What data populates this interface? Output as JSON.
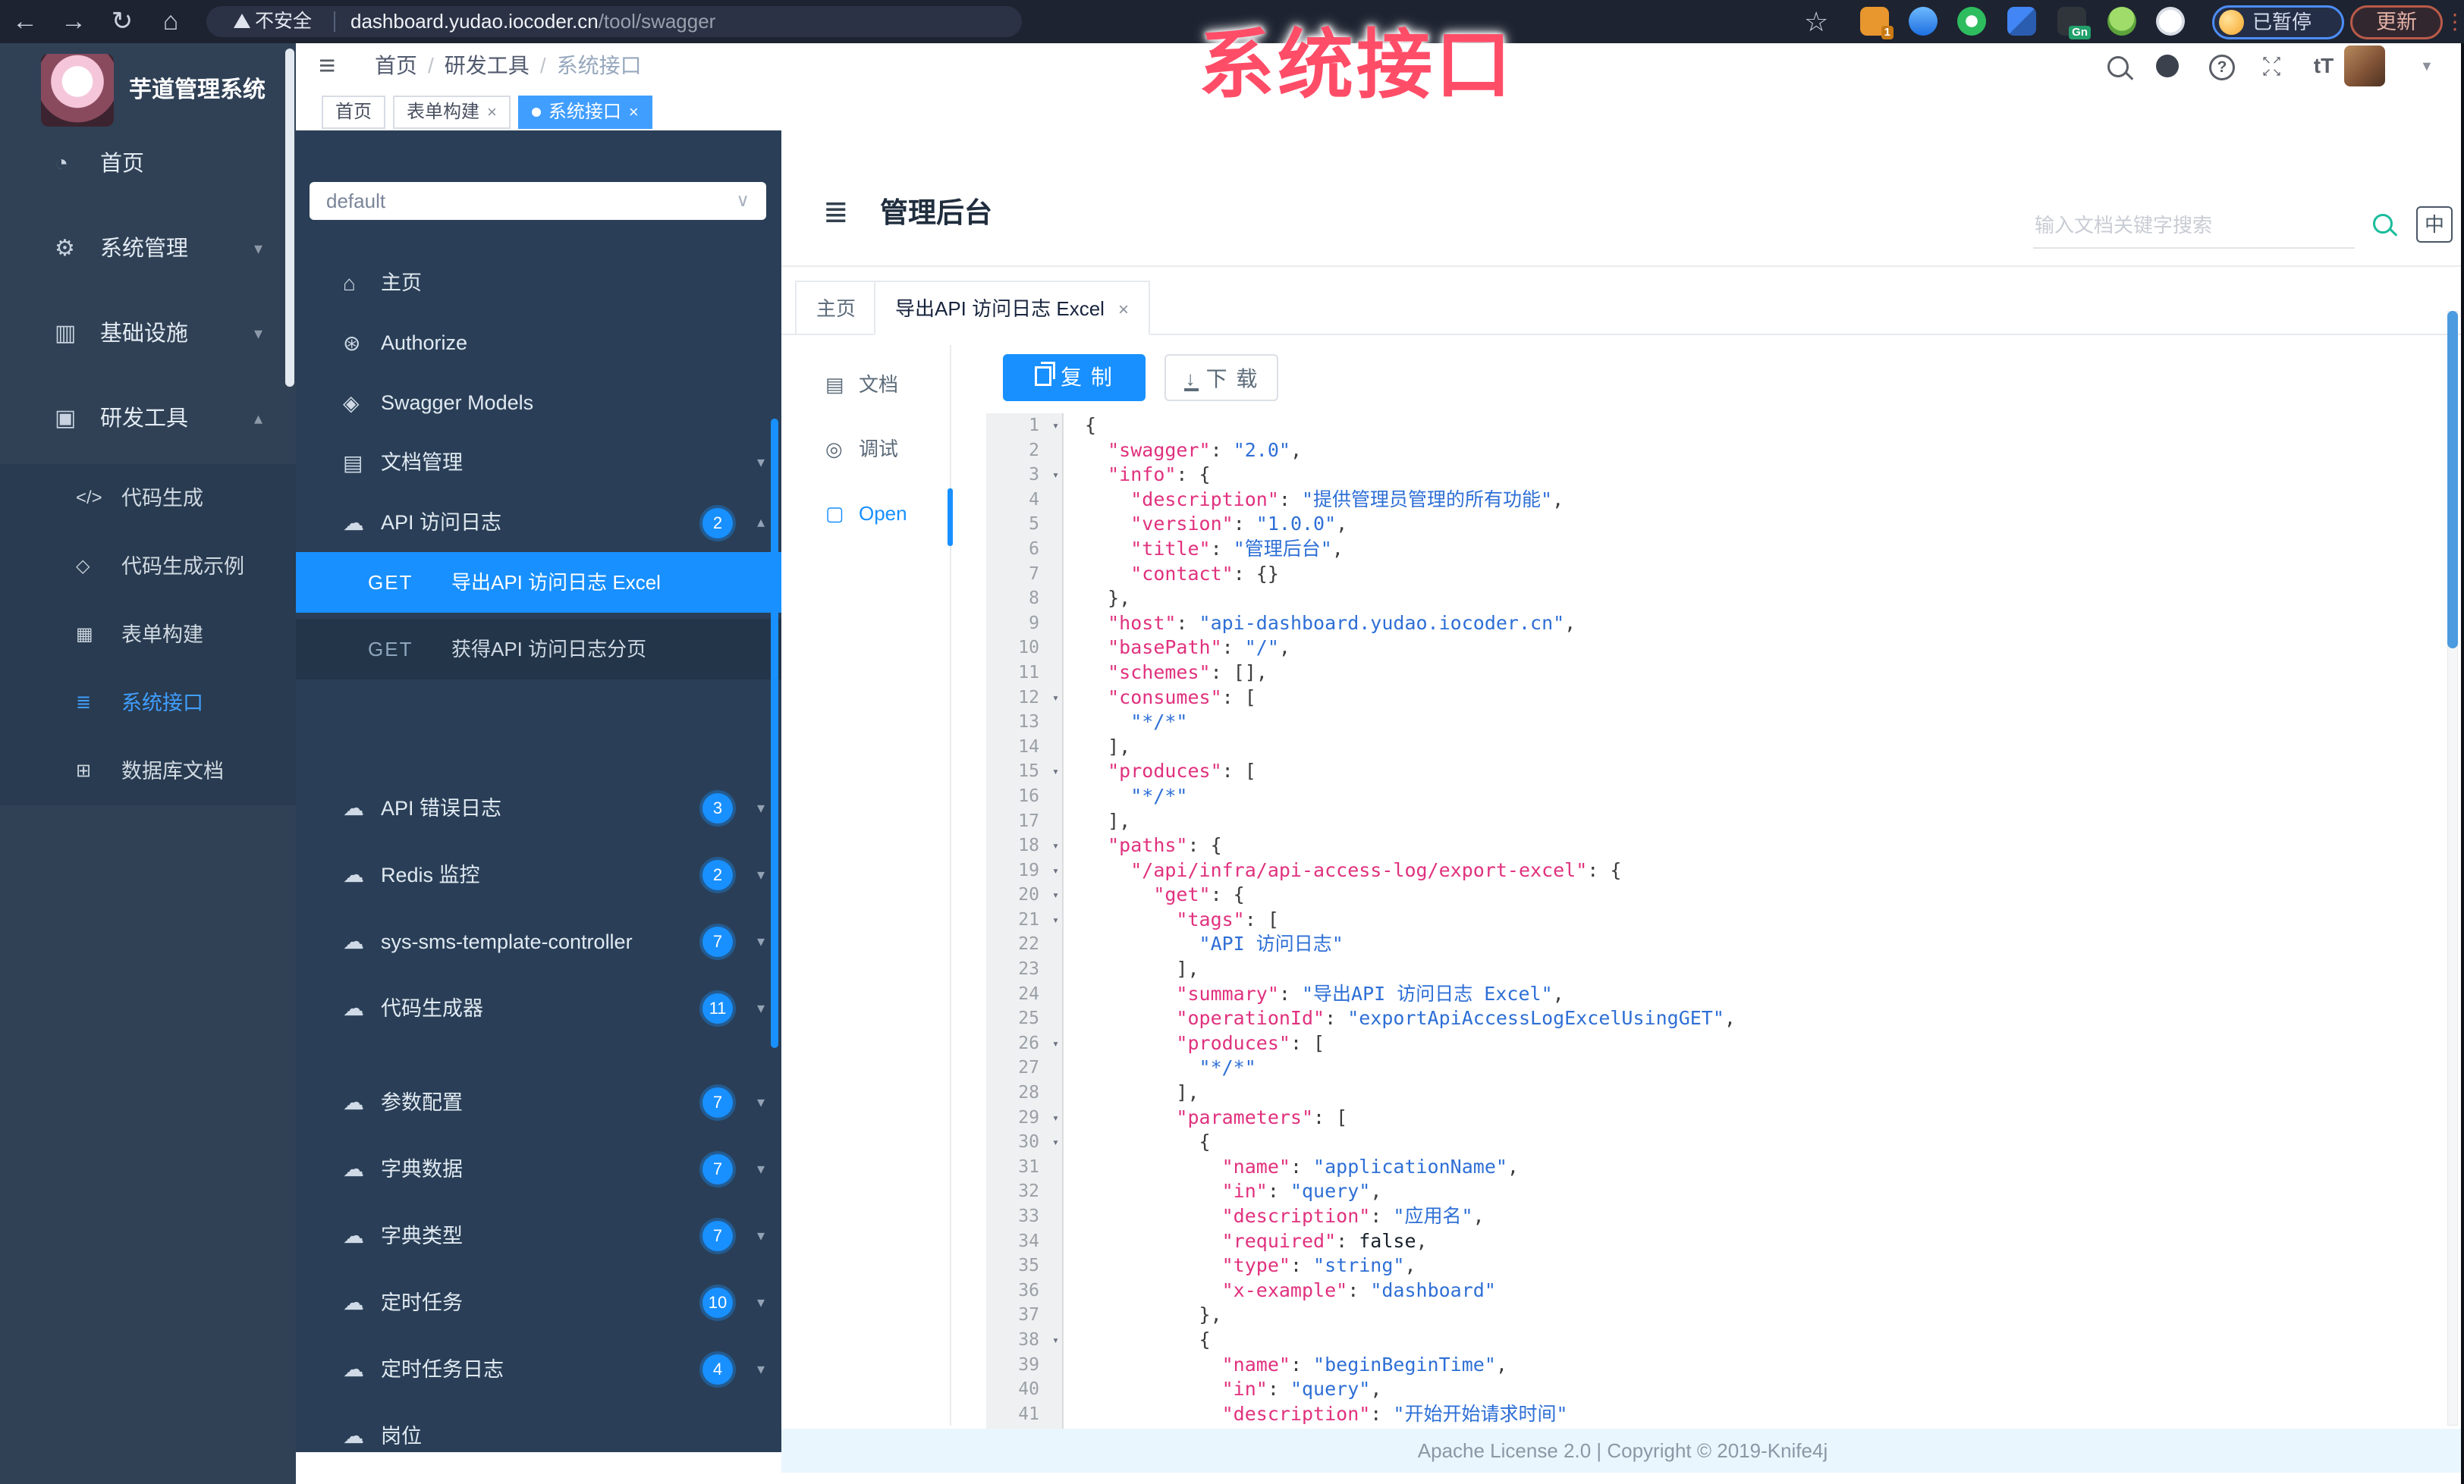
{
  "watermark": "系统接口",
  "browser": {
    "security_label": "不安全",
    "url_host": "dashboard.yudao.iocoder.cn",
    "url_path": "/tool/swagger",
    "ext1_badge": "1",
    "ext_gn_badge": "Gn",
    "paused_label": "已暂停",
    "update_label": "更新"
  },
  "header": {
    "breadcrumb": [
      "首页",
      "研发工具",
      "系统接口"
    ],
    "font_size_label": "tT"
  },
  "tags": [
    {
      "label": "首页",
      "close": "",
      "active": false
    },
    {
      "label": "表单构建",
      "close": "×",
      "active": false
    },
    {
      "label": "系统接口",
      "close": "×",
      "active": true
    }
  ],
  "sidebar": {
    "logo_title": "芋道管理系统",
    "items": [
      {
        "glyph": "◔",
        "label": "首页",
        "chevron": ""
      },
      {
        "glyph": "⚙",
        "label": "系统管理",
        "chevron": "▾"
      },
      {
        "glyph": "▥",
        "label": "基础设施",
        "chevron": "▾"
      },
      {
        "glyph": "▣",
        "label": "研发工具",
        "chevron": "▴"
      }
    ],
    "sub_items": [
      {
        "glyph": "</>",
        "label": "代码生成",
        "active": false
      },
      {
        "glyph": "◇",
        "label": "代码生成示例",
        "active": false
      },
      {
        "glyph": "▦",
        "label": "表单构建",
        "active": false
      },
      {
        "glyph": "≣",
        "label": "系统接口",
        "active": true
      },
      {
        "glyph": "⊞",
        "label": "数据库文档",
        "active": false
      }
    ]
  },
  "swagger_nav": {
    "group_select_value": "default",
    "top_items": [
      {
        "glyph": "⌂",
        "label": "主页",
        "badge": "",
        "chevron": ""
      },
      {
        "glyph": "⊛",
        "label": "Authorize",
        "badge": "",
        "chevron": ""
      },
      {
        "glyph": "◈",
        "label": "Swagger Models",
        "badge": "",
        "chevron": ""
      },
      {
        "glyph": "▤",
        "label": "文档管理",
        "badge": "",
        "chevron": "▾"
      },
      {
        "glyph": "☁",
        "label": "API 访问日志",
        "badge": "2",
        "chevron": "▴"
      }
    ],
    "get_rows": [
      {
        "method": "GET",
        "label": "导出API 访问日志 Excel",
        "active": true
      },
      {
        "method": "GET",
        "label": "获得API 访问日志分页",
        "active": false
      }
    ],
    "controllers": [
      {
        "glyph": "☁",
        "label": "API 错误日志",
        "badge": "3",
        "chevron": "▾"
      },
      {
        "glyph": "☁",
        "label": "Redis 监控",
        "badge": "2",
        "chevron": "▾"
      },
      {
        "glyph": "☁",
        "label": "sys-sms-template-controller",
        "badge": "7",
        "chevron": "▾"
      },
      {
        "glyph": "☁",
        "label": "代码生成器",
        "badge": "11",
        "chevron": "▾"
      },
      {
        "glyph": "☁",
        "label": "参数配置",
        "badge": "7",
        "chevron": "▾"
      },
      {
        "glyph": "☁",
        "label": "字典数据",
        "badge": "7",
        "chevron": "▾"
      },
      {
        "glyph": "☁",
        "label": "字典类型",
        "badge": "7",
        "chevron": "▾"
      },
      {
        "glyph": "☁",
        "label": "定时任务",
        "badge": "10",
        "chevron": "▾"
      },
      {
        "glyph": "☁",
        "label": "定时任务日志",
        "badge": "4",
        "chevron": "▾"
      },
      {
        "glyph": "☁",
        "label": "岗位",
        "badge": "",
        "chevron": ""
      }
    ]
  },
  "main": {
    "title": "管理后台",
    "search_placeholder": "输入文档关键字搜索",
    "lang_label": "中",
    "doc_tabs": [
      {
        "label": "主页",
        "close": "",
        "active": false
      },
      {
        "label": "导出API 访问日志 Excel",
        "close": "×",
        "active": true
      }
    ],
    "side_tabs": [
      {
        "glyph": "▤",
        "label": "文档",
        "active": false
      },
      {
        "glyph": "◎",
        "label": "调试",
        "active": false
      },
      {
        "glyph": "▢",
        "label": "Open",
        "active": true
      }
    ],
    "copy_label": "复 制",
    "download_label": "下 载",
    "footer": "Apache License 2.0 | Copyright © 2019-Knife4j"
  },
  "code": {
    "folds": [
      1,
      3,
      12,
      15,
      18,
      19,
      20,
      21,
      26,
      29,
      30,
      38
    ],
    "lines": [
      "{",
      "  \"swagger\": \"2.0\",",
      "  \"info\": {",
      "    \"description\": \"提供管理员管理的所有功能\",",
      "    \"version\": \"1.0.0\",",
      "    \"title\": \"管理后台\",",
      "    \"contact\": {}",
      "  },",
      "  \"host\": \"api-dashboard.yudao.iocoder.cn\",",
      "  \"basePath\": \"/\",",
      "  \"schemes\": [],",
      "  \"consumes\": [",
      "    \"*/*\"",
      "  ],",
      "  \"produces\": [",
      "    \"*/*\"",
      "  ],",
      "  \"paths\": {",
      "    \"/api/infra/api-access-log/export-excel\": {",
      "      \"get\": {",
      "        \"tags\": [",
      "          \"API 访问日志\"",
      "        ],",
      "        \"summary\": \"导出API 访问日志 Excel\",",
      "        \"operationId\": \"exportApiAccessLogExcelUsingGET\",",
      "        \"produces\": [",
      "          \"*/*\"",
      "        ],",
      "        \"parameters\": [",
      "          {",
      "            \"name\": \"applicationName\",",
      "            \"in\": \"query\",",
      "            \"description\": \"应用名\",",
      "            \"required\": false,",
      "            \"type\": \"string\",",
      "            \"x-example\": \"dashboard\"",
      "          },",
      "          {",
      "            \"name\": \"beginBeginTime\",",
      "            \"in\": \"query\",",
      "            \"description\": \"开始开始请求时间\""
    ]
  }
}
